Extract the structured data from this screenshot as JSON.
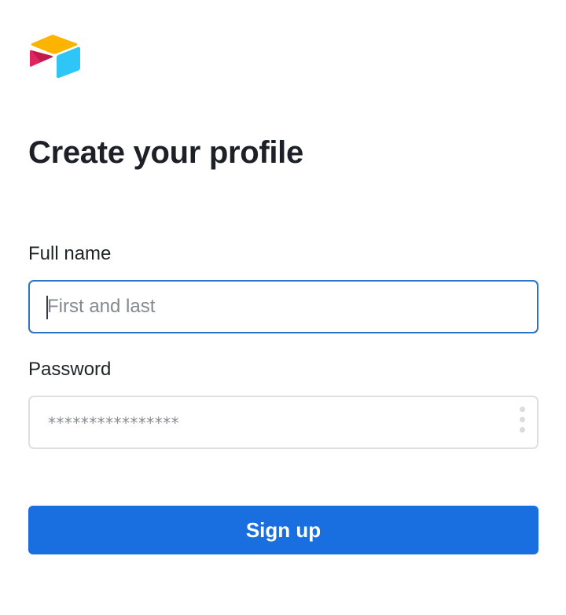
{
  "brand": {
    "logo_icon": "airtable-logo-icon",
    "colors": {
      "yellow": "#fcb400",
      "red": "#e0245e",
      "cyan": "#2ec5f7",
      "dark_red": "#a3123a"
    }
  },
  "page": {
    "title": "Create your profile"
  },
  "form": {
    "full_name": {
      "label": "Full name",
      "value": "",
      "placeholder": "First and last"
    },
    "password": {
      "label": "Password",
      "mask": "****************",
      "menu_icon": "vertical-dots-icon"
    },
    "submit_label": "Sign up"
  },
  "theme": {
    "primary": "#1a6fe0",
    "focus_border": "#2d74c4",
    "border": "#dddfe2",
    "text": "#1f2328"
  }
}
